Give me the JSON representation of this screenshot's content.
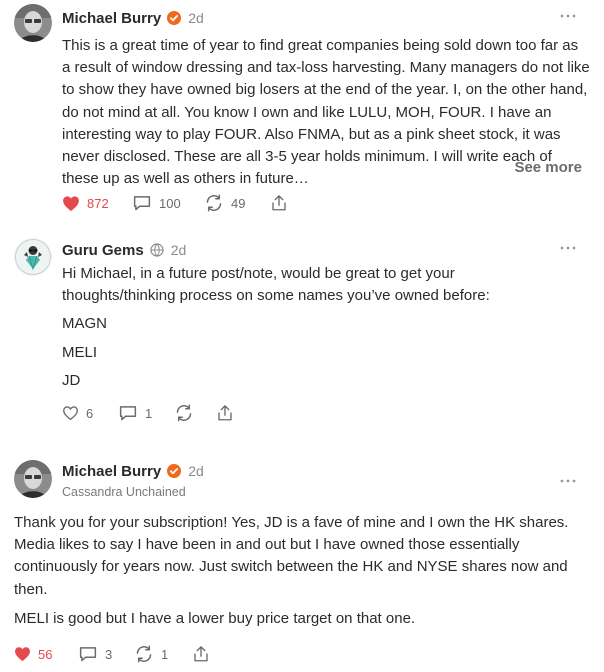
{
  "notes": [
    {
      "author": "Michael Burry",
      "time": "2d",
      "paragraphs": [
        "This is a great time of year to find great companies being sold down too far as a result of window dressing and tax-loss harvesting. Many managers do not like to show they have owned big losers at the end of the year. I, on the other hand, do not mind at all. You know I own and like LULU, MOH, FOUR. I have an interesting way to play FOUR. Also FNMA, but as a pink sheet stock, it was never disclosed. These are all 3-5 year holds minimum. I will write each of these up as well as others in future…"
      ],
      "see_more": "See more",
      "likes": "872",
      "comments": "100",
      "restacks": "49",
      "liked": true
    },
    {
      "author": "Guru Gems",
      "time": "2d",
      "paragraphs": [
        "Hi Michael, in a future post/note, would be great to get your thoughts/thinking process on some names you’ve owned before:",
        "MAGN",
        "MELI",
        "JD"
      ],
      "likes": "6",
      "comments": "1",
      "liked": false
    },
    {
      "author": "Michael Burry",
      "time": "2d",
      "subline": "Cassandra Unchained",
      "paragraphs": [
        "Thank you for your subscription! Yes, JD is a fave of mine and I own the HK shares. Media likes to say I have been in and out but I have owned those essentially continuously for years now. Just switch between the HK and NYSE shares now and then.",
        "MELI is good but I have a lower buy price target on that one."
      ],
      "likes": "56",
      "comments": "3",
      "restacks": "1",
      "liked": true
    }
  ],
  "colors": {
    "like_active": "#e5484d",
    "badge_orange": "#f06a1d",
    "muted": "#8a8a8a"
  }
}
